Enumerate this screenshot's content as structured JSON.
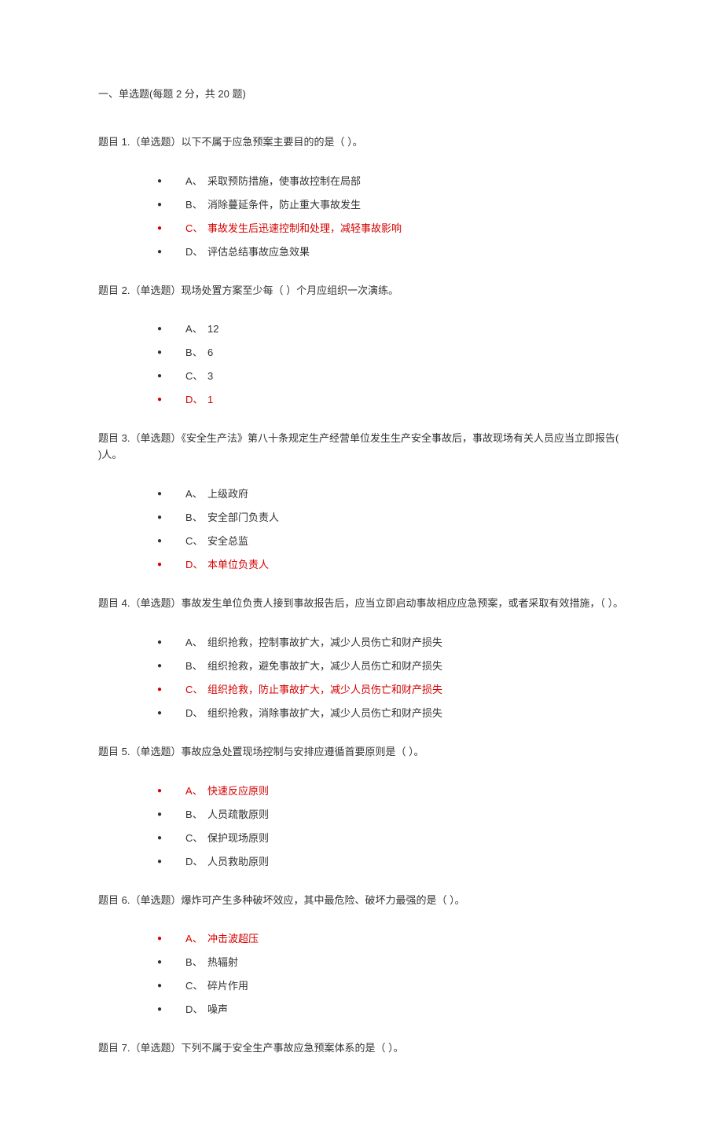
{
  "section_header": "一、单选题(每题 2 分，共 20 题)",
  "questions": [
    {
      "prompt": "题目 1.（单选题）以下不属于应急预案主要目的的是（ ）。",
      "options": [
        {
          "letter": "A、",
          "text": "采取预防措施，使事故控制在局部",
          "correct": false
        },
        {
          "letter": "B、",
          "text": "消除蔓延条件，防止重大事故发生",
          "correct": false
        },
        {
          "letter": "C、",
          "text": "事故发生后迅速控制和处理，减轻事故影响",
          "correct": true
        },
        {
          "letter": "D、",
          "text": "评估总结事故应急效果",
          "correct": false
        }
      ]
    },
    {
      "prompt": "题目 2.（单选题）现场处置方案至少每（ ）个月应组织一次演练。",
      "options": [
        {
          "letter": "A、",
          "text": "12",
          "correct": false
        },
        {
          "letter": "B、",
          "text": "6",
          "correct": false
        },
        {
          "letter": "C、",
          "text": "3",
          "correct": false
        },
        {
          "letter": "D、",
          "text": "1",
          "correct": true
        }
      ]
    },
    {
      "prompt": "题目 3.（单选题）《安全生产法》第八十条规定生产经营单位发生生产安全事故后，事故现场有关人员应当立即报告( )人。",
      "options": [
        {
          "letter": "A、",
          "text": "上级政府",
          "correct": false
        },
        {
          "letter": "B、",
          "text": "安全部门负责人",
          "correct": false
        },
        {
          "letter": "C、",
          "text": "安全总监",
          "correct": false
        },
        {
          "letter": "D、",
          "text": "本单位负责人",
          "correct": true
        }
      ]
    },
    {
      "prompt": "题目 4.（单选题）事故发生单位负责人接到事故报告后，应当立即启动事故相应应急预案，或者采取有效措施，（ ）。",
      "options": [
        {
          "letter": "A、",
          "text": "组织抢救，控制事故扩大，减少人员伤亡和财产损失",
          "correct": false
        },
        {
          "letter": "B、",
          "text": "组织抢救，避免事故扩大，减少人员伤亡和财产损失",
          "correct": false
        },
        {
          "letter": "C、",
          "text": "组织抢救，防止事故扩大，减少人员伤亡和财产损失",
          "correct": true
        },
        {
          "letter": "D、",
          "text": "组织抢救，消除事故扩大，减少人员伤亡和财产损失",
          "correct": false
        }
      ]
    },
    {
      "prompt": "题目 5.（单选题）事故应急处置现场控制与安排应遵循首要原则是（ ）。",
      "options": [
        {
          "letter": "A、",
          "text": "快速反应原则",
          "correct": true
        },
        {
          "letter": "B、",
          "text": "人员疏散原则",
          "correct": false
        },
        {
          "letter": "C、",
          "text": "保护现场原则",
          "correct": false
        },
        {
          "letter": "D、",
          "text": "人员救助原则",
          "correct": false
        }
      ]
    },
    {
      "prompt": "题目 6.（单选题）爆炸可产生多种破坏效应，其中最危险、破坏力最强的是（ ）。",
      "options": [
        {
          "letter": "A、",
          "text": "冲击波超压",
          "correct": true
        },
        {
          "letter": "B、",
          "text": "热辐射",
          "correct": false
        },
        {
          "letter": "C、",
          "text": "碎片作用",
          "correct": false
        },
        {
          "letter": "D、",
          "text": "噪声",
          "correct": false
        }
      ]
    },
    {
      "prompt": "题目 7.（单选题）下列不属于安全生产事故应急预案体系的是（ ）。",
      "options": []
    }
  ]
}
